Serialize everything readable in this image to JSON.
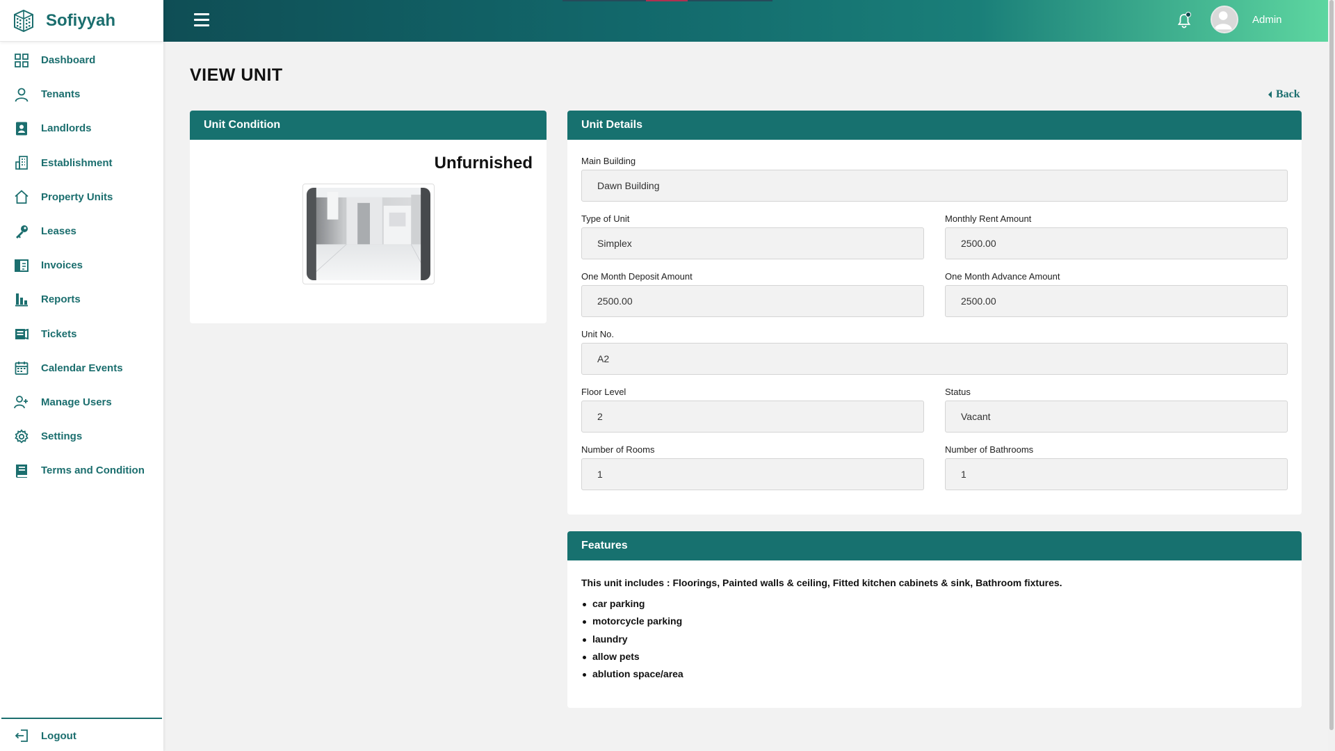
{
  "brand": {
    "name": "Sofiyyah"
  },
  "colors": {
    "primary": "#17716f",
    "topbar_end": "#5dd6a0"
  },
  "sidebar": {
    "items": [
      {
        "label": "Dashboard",
        "icon": "grid-icon"
      },
      {
        "label": "Tenants",
        "icon": "user-icon"
      },
      {
        "label": "Landlords",
        "icon": "contact-card-icon"
      },
      {
        "label": "Establishment",
        "icon": "building-icon"
      },
      {
        "label": "Property Units",
        "icon": "home-icon"
      },
      {
        "label": "Leases",
        "icon": "key-icon"
      },
      {
        "label": "Invoices",
        "icon": "invoice-icon"
      },
      {
        "label": "Reports",
        "icon": "bar-chart-icon"
      },
      {
        "label": "Tickets",
        "icon": "ticket-icon"
      },
      {
        "label": "Calendar Events",
        "icon": "calendar-icon"
      },
      {
        "label": "Manage Users",
        "icon": "user-plus-icon"
      },
      {
        "label": "Settings",
        "icon": "gear-icon"
      },
      {
        "label": "Terms and Condition",
        "icon": "book-icon"
      }
    ],
    "logout": "Logout"
  },
  "header": {
    "user": "Admin"
  },
  "page": {
    "title": "VIEW UNIT",
    "back": "Back"
  },
  "condition": {
    "heading": "Unit Condition",
    "value": "Unfurnished"
  },
  "details": {
    "heading": "Unit Details",
    "fields": {
      "main_building": {
        "label": "Main Building",
        "value": "Dawn Building"
      },
      "type_of_unit": {
        "label": "Type of Unit",
        "value": "Simplex"
      },
      "monthly_rent": {
        "label": "Monthly Rent Amount",
        "value": "2500.00"
      },
      "deposit": {
        "label": "One Month Deposit Amount",
        "value": "2500.00"
      },
      "advance": {
        "label": "One Month Advance Amount",
        "value": "2500.00"
      },
      "unit_no": {
        "label": "Unit No.",
        "value": "A2"
      },
      "floor_level": {
        "label": "Floor Level",
        "value": "2"
      },
      "status": {
        "label": "Status",
        "value": "Vacant"
      },
      "rooms": {
        "label": "Number of Rooms",
        "value": "1"
      },
      "bathrooms": {
        "label": "Number of Bathrooms",
        "value": "1"
      }
    }
  },
  "features": {
    "heading": "Features",
    "intro": "This unit includes : Floorings, Painted walls & ceiling, Fitted kitchen cabinets & sink, Bathroom fixtures.",
    "items": [
      "car parking",
      "motorcycle parking",
      "laundry",
      "allow pets",
      "ablution space/area"
    ]
  }
}
